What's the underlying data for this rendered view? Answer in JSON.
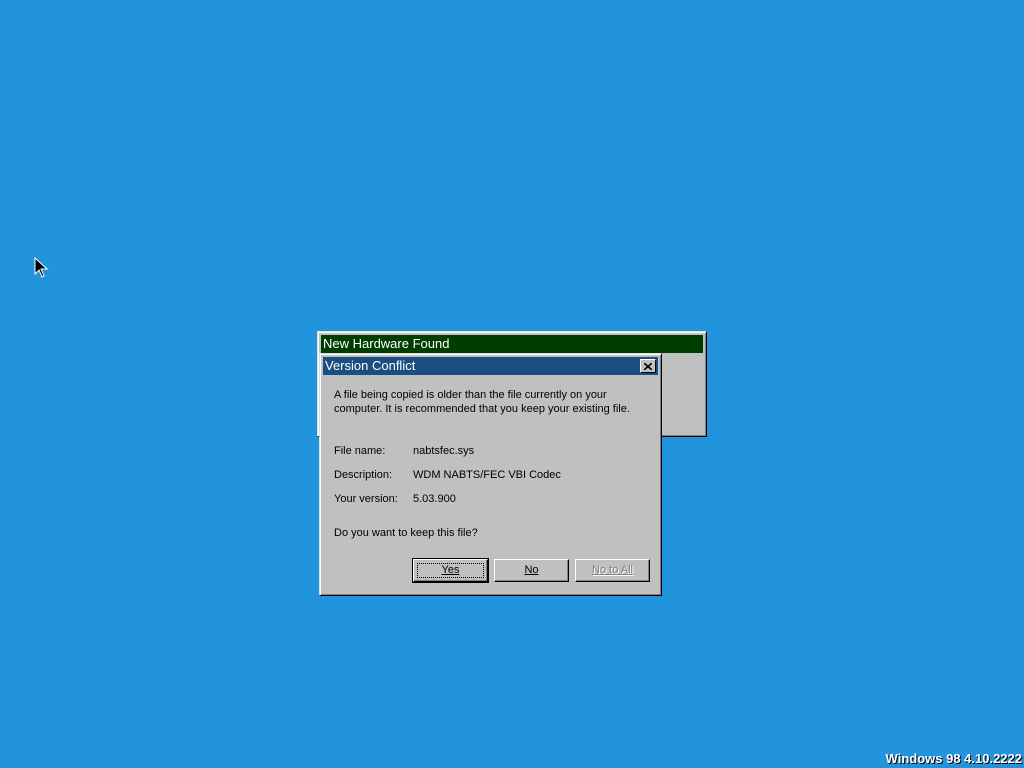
{
  "background_window": {
    "title": "New Hardware Found"
  },
  "dialog": {
    "title": "Version Conflict",
    "message": "A file being copied is older than the file currently on your computer. It is recommended that you keep your existing file.",
    "fields": [
      {
        "label": "File name:",
        "value": "nabtsfec.sys"
      },
      {
        "label": "Description:",
        "value": "WDM NABTS/FEC VBI Codec"
      },
      {
        "label": "Your version:",
        "value": "5.03.900"
      }
    ],
    "question": "Do you want to keep this file?",
    "buttons": {
      "yes": "Yes",
      "no": "No",
      "no_to_all": "No to All"
    }
  },
  "desktop": {
    "version_text": "Windows 98 4.10.2222",
    "background_color": "#2294dd"
  },
  "icons": {
    "cursor": "arrow-cursor-icon",
    "close": "close-icon"
  }
}
